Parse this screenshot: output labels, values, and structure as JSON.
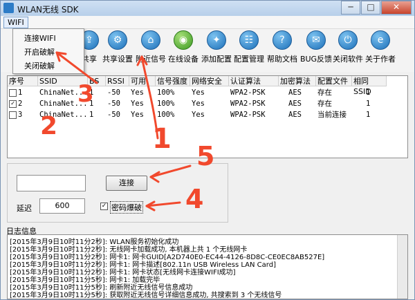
{
  "window": {
    "title": "WLAN无线 SDK",
    "controls": {
      "minimize": "─",
      "maximize": "□",
      "close": "✕"
    }
  },
  "menu": {
    "wifi": "WIFI",
    "dropdown": [
      "连接WIFI",
      "开启破解",
      "关闭破解"
    ]
  },
  "toolbar": [
    {
      "label": "共享",
      "icon": "share-icon"
    },
    {
      "label": "共享设置",
      "icon": "settings-icon"
    },
    {
      "label": "附近信号",
      "icon": "signal-icon"
    },
    {
      "label": "在线设备",
      "icon": "android-icon"
    },
    {
      "label": "添加配置",
      "icon": "add-icon"
    },
    {
      "label": "配置管理",
      "icon": "manage-icon"
    },
    {
      "label": "帮助文档",
      "icon": "help-icon"
    },
    {
      "label": "BUG反馈",
      "icon": "bug-icon"
    },
    {
      "label": "关闭软件",
      "icon": "power-icon"
    },
    {
      "label": "关于作者",
      "icon": "ie-icon"
    }
  ],
  "table": {
    "headers": [
      "序号",
      "SSID",
      "BS",
      "RSSI",
      "可用",
      "信号强度",
      "网络安全",
      "认证算法",
      "加密算法",
      "配置文件",
      "相同SSID"
    ],
    "rows": [
      {
        "checked": false,
        "no": "1",
        "ssid": "ChinaNet...",
        "bs": "1",
        "rssi": "-50",
        "avail": "Yes",
        "signal": "100%",
        "secure": "Yes",
        "auth": "WPA2-PSK",
        "cipher": "AES",
        "profile": "存在",
        "same": "1"
      },
      {
        "checked": true,
        "no": "2",
        "ssid": "ChinaNet...",
        "bs": "1",
        "rssi": "-50",
        "avail": "Yes",
        "signal": "100%",
        "secure": "Yes",
        "auth": "WPA2-PSK",
        "cipher": "AES",
        "profile": "存在",
        "same": "1"
      },
      {
        "checked": false,
        "no": "3",
        "ssid": "ChinaNet...",
        "bs": "1",
        "rssi": "-50",
        "avail": "Yes",
        "signal": "100%",
        "secure": "Yes",
        "auth": "WPA2-PSK",
        "cipher": "AES",
        "profile": "当前连接",
        "same": "1"
      }
    ]
  },
  "controls": {
    "connect": "连接",
    "delay_label": "延迟",
    "delay_value": "600",
    "crack_label": "密码爆破",
    "crack_checked": true
  },
  "log": {
    "title": "日志信息",
    "lines": [
      "[2015年3月9日10时11分2秒]: WLAN服务初始化成功",
      "[2015年3月9日10时11分2秒]: 无线网卡加载成功, 本机器上共 1 个无线网卡",
      "[2015年3月9日10时11分2秒]: 网卡1: 网卡GUID[A2D740E0-EC44-4126-8D8C-CE0EC8AB527E]",
      "[2015年3月9日10时11分2秒]: 网卡1: 网卡描述[802.11n USB Wireless LAN Card]",
      "[2015年3月9日10时11分2秒]: 网卡1: 网卡状态[无线网卡连接WIFI成功]",
      "[2015年3月9日10时11分5秒]: 网卡1: 加载完毕",
      "[2015年3月9日10时11分5秒]: 刷新附近无线信号信息成功",
      "[2015年3月9日10时11分5秒]: 获取附近无线信号详细信息成功, 共搜索到 3 个无线信号"
    ]
  },
  "annotations": [
    "1",
    "2",
    "3",
    "4",
    "5"
  ],
  "colors": {
    "annotation": "#f1492d",
    "title_bar": "#b7cfea",
    "close_button": "#c8442c"
  }
}
